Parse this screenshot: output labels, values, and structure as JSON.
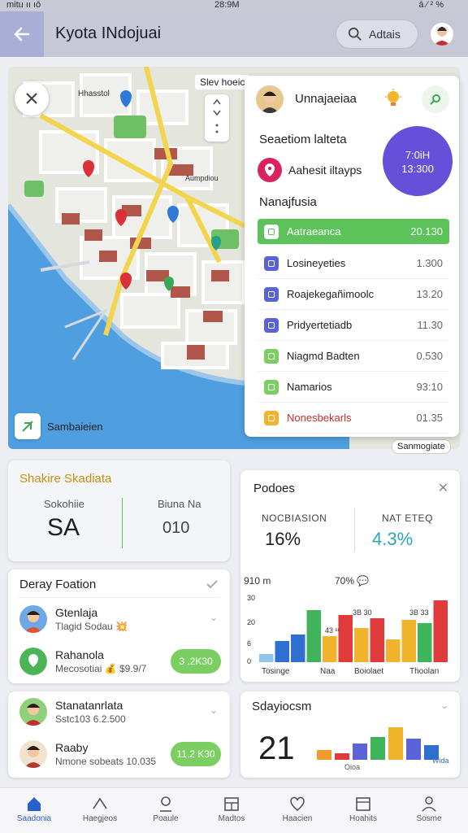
{
  "status_bar": {
    "left": "mitu ıı ıō",
    "time": "28:9M",
    "right": "ā ⁄ ² %"
  },
  "header": {
    "title": "Kyota INdojuai",
    "search_label": "Adtais"
  },
  "map": {
    "label": "Slev hoeic",
    "legend_label": "Sambaieien",
    "corner_label": "Sanmogiate",
    "street_labels": [
      "Hhasstol",
      "Aumpdiou"
    ]
  },
  "station": {
    "name": "Unnajaeiaa",
    "section_title": "Seaetiom lalteta",
    "address": "Aahesit iltayps",
    "circle_line1": "7:0iH",
    "circle_line2": "13:300",
    "list_title": "Nanajfusia",
    "rows": [
      {
        "label": "Aatraeanca",
        "value": "20.130",
        "color": "#5cc35a"
      },
      {
        "label": "Losineyeties",
        "value": "1.300",
        "color": "#5a63d6"
      },
      {
        "label": "Roajekegañimoolc",
        "value": "13.20",
        "color": "#5a63d6"
      },
      {
        "label": "Pridyertetiadb",
        "value": "11.30",
        "color": "#5a63d6"
      },
      {
        "label": "Niagmd Badten",
        "value": "0.530",
        "color": "#7bcf62"
      },
      {
        "label": "Namarios",
        "value": "93:10",
        "color": "#7bcf62"
      },
      {
        "label": "Nonesbekarls",
        "value": "01.35",
        "color": "#f2b32c"
      }
    ]
  },
  "summary": {
    "title": "Shakire Skadiata",
    "label1": "Sokohiie",
    "value1": "SA",
    "label2": "Biuna Na",
    "value2": "010"
  },
  "delay": {
    "title": "Deray Foation",
    "people": [
      {
        "name": "Gtenlaja",
        "sub": "Tlagid Sodau 💥",
        "pill": ""
      },
      {
        "name": "Rahanola",
        "sub": "Mecosotiai 💰 $9.9/7",
        "pill": "3 .2K30"
      }
    ]
  },
  "podoes": {
    "title": "Podoes",
    "label1": "NOCBIASION",
    "value1": "16%",
    "label2": "NAT ETEQ",
    "value2": "4.3%"
  },
  "chart_data": {
    "type": "bar",
    "title": "",
    "annotations": [
      "910 m",
      "70% 💬",
      "30",
      "20",
      "6",
      "0",
      "43 ᵋᵋ",
      "3B 30",
      "3B 33"
    ],
    "categories": [
      "Tosinge",
      "Naa",
      "Boiolaet",
      "Thoolan"
    ],
    "series": [
      {
        "values": [
          10,
          26,
          34,
          64,
          32,
          58,
          42,
          54,
          28,
          52,
          48,
          76
        ]
      }
    ],
    "colors": [
      "#8fc4ef",
      "#2f6fcf",
      "#2f6fcf",
      "#40b45a",
      "#f2b32c",
      "#e03a3a",
      "#f2b32c",
      "#e03a3a",
      "#f2b32c",
      "#f2b32c",
      "#40b45a",
      "#e03a3a"
    ],
    "ylim": [
      0,
      100
    ]
  },
  "contacts": {
    "people": [
      {
        "name": "Stanatanrlata",
        "sub": "Sstc103 6.2.500",
        "pill": ""
      },
      {
        "name": "Raaby",
        "sub": "Nmone sobeats 10.035",
        "pill": "11.2 K30"
      }
    ]
  },
  "syday": {
    "title": "Sdayiocsm",
    "value": "21",
    "axis_labels": [
      "Oioa",
      "Wida"
    ],
    "bars": [
      12,
      8,
      20,
      28,
      40,
      26,
      18
    ]
  },
  "nav": [
    {
      "label": "Saadonia",
      "icon": "home-icon"
    },
    {
      "label": "Haegjeos",
      "icon": "stats-icon"
    },
    {
      "label": "Poaule",
      "icon": "person-icon"
    },
    {
      "label": "Madtos",
      "icon": "calendar-icon"
    },
    {
      "label": "Haacien",
      "icon": "heart-icon"
    },
    {
      "label": "Hoahits",
      "icon": "inbox-icon"
    },
    {
      "label": "Sosme",
      "icon": "profile-icon"
    }
  ]
}
